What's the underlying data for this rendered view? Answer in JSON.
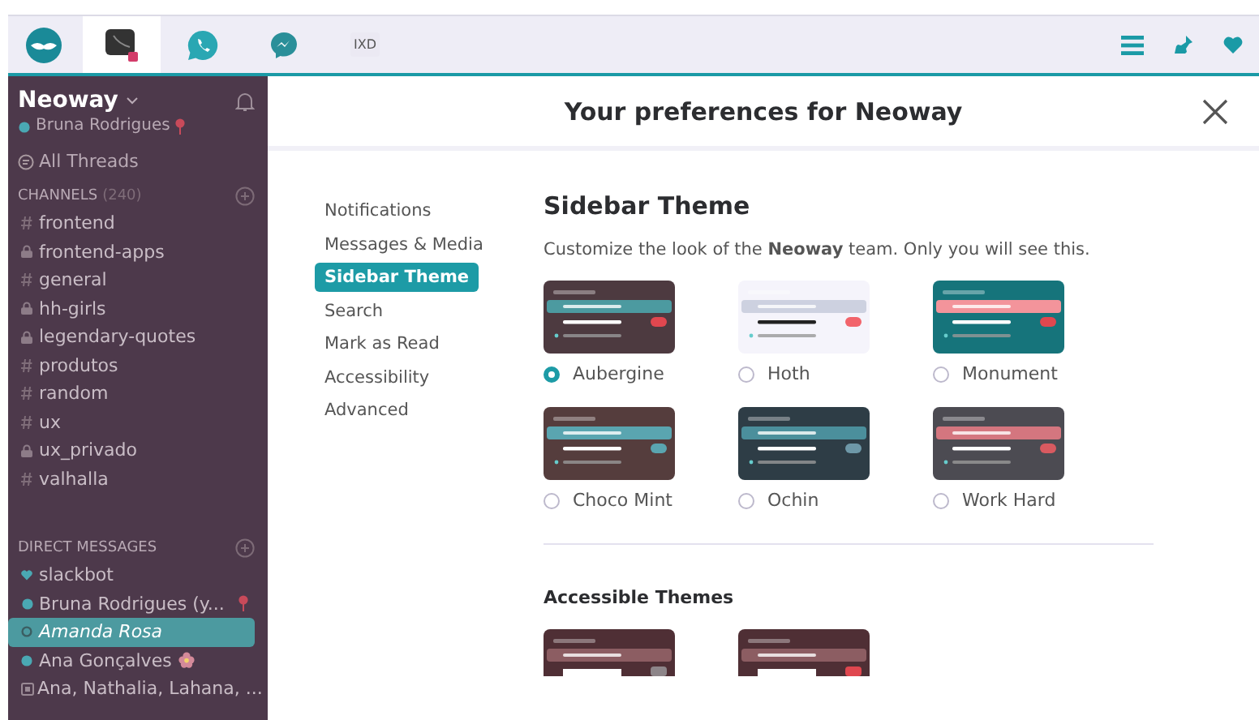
{
  "workspace_tabs": [
    {
      "kind": "mascot",
      "selected": false
    },
    {
      "kind": "dark",
      "selected": true
    },
    {
      "kind": "phone",
      "selected": false
    },
    {
      "kind": "chat",
      "selected": false
    },
    {
      "kind": "ixd",
      "label": "IXD",
      "selected": false
    }
  ],
  "sidebar": {
    "team": "Neoway",
    "user": "Bruna Rodrigues",
    "all_threads": "All Threads",
    "channels_heading": "CHANNELS",
    "channels_count": "(240)",
    "channels": [
      {
        "name": "frontend",
        "kind": "public",
        "selected": false
      },
      {
        "name": "frontend-apps",
        "kind": "private",
        "selected": false
      },
      {
        "name": "general",
        "kind": "public",
        "selected": false
      },
      {
        "name": "hh-girls",
        "kind": "private",
        "selected": false
      },
      {
        "name": "legendary-quotes",
        "kind": "private",
        "selected": false
      },
      {
        "name": "produtos",
        "kind": "public",
        "selected": false
      },
      {
        "name": "random",
        "kind": "public",
        "selected": false
      },
      {
        "name": "ux",
        "kind": "public",
        "selected": false
      },
      {
        "name": "ux_privado",
        "kind": "private",
        "selected": false
      },
      {
        "name": "valhalla",
        "kind": "public",
        "selected": false
      }
    ],
    "dm_heading": "DIRECT MESSAGES",
    "direct_messages": [
      {
        "name": "slackbot",
        "kind": "bot",
        "selected": false
      },
      {
        "name": "Bruna Rodrigues (y...",
        "kind": "self",
        "selected": false
      },
      {
        "name": "Amanda Rosa",
        "kind": "away",
        "selected": true
      },
      {
        "name": "Ana Gonçalves",
        "kind": "online",
        "selected": false
      },
      {
        "name": "Ana, Nathalia, Lahana, ...",
        "kind": "group",
        "selected": false
      }
    ]
  },
  "dialog": {
    "title": "Your preferences for Neoway",
    "nav": [
      {
        "label": "Notifications",
        "selected": false
      },
      {
        "label": "Messages & Media",
        "selected": false
      },
      {
        "label": "Sidebar Theme",
        "selected": true
      },
      {
        "label": "Search",
        "selected": false
      },
      {
        "label": "Mark as Read",
        "selected": false
      },
      {
        "label": "Accessibility",
        "selected": false
      },
      {
        "label": "Advanced",
        "selected": false
      }
    ],
    "section_title": "Sidebar Theme",
    "description": "Customize the look of the **Neoway** team. Only you will see this.",
    "themes": [
      {
        "name": "Aubergine",
        "color": "#4d3a40",
        "selected": true
      },
      {
        "name": "Hoth",
        "color": "#f5f4fb",
        "selected": false
      },
      {
        "name": "Monument",
        "color": "#16747b",
        "selected": false
      },
      {
        "name": "Choco Mint",
        "color": "#553d3d",
        "selected": false
      },
      {
        "name": "Ochin",
        "color": "#2e3d46",
        "selected": false
      },
      {
        "name": "Work Hard",
        "color": "#4c4b52",
        "selected": false
      }
    ],
    "accessible_heading": "Accessible Themes",
    "accessible_themes": [
      {
        "color": "#4f2f35"
      },
      {
        "color": "#4f2f35"
      }
    ]
  }
}
